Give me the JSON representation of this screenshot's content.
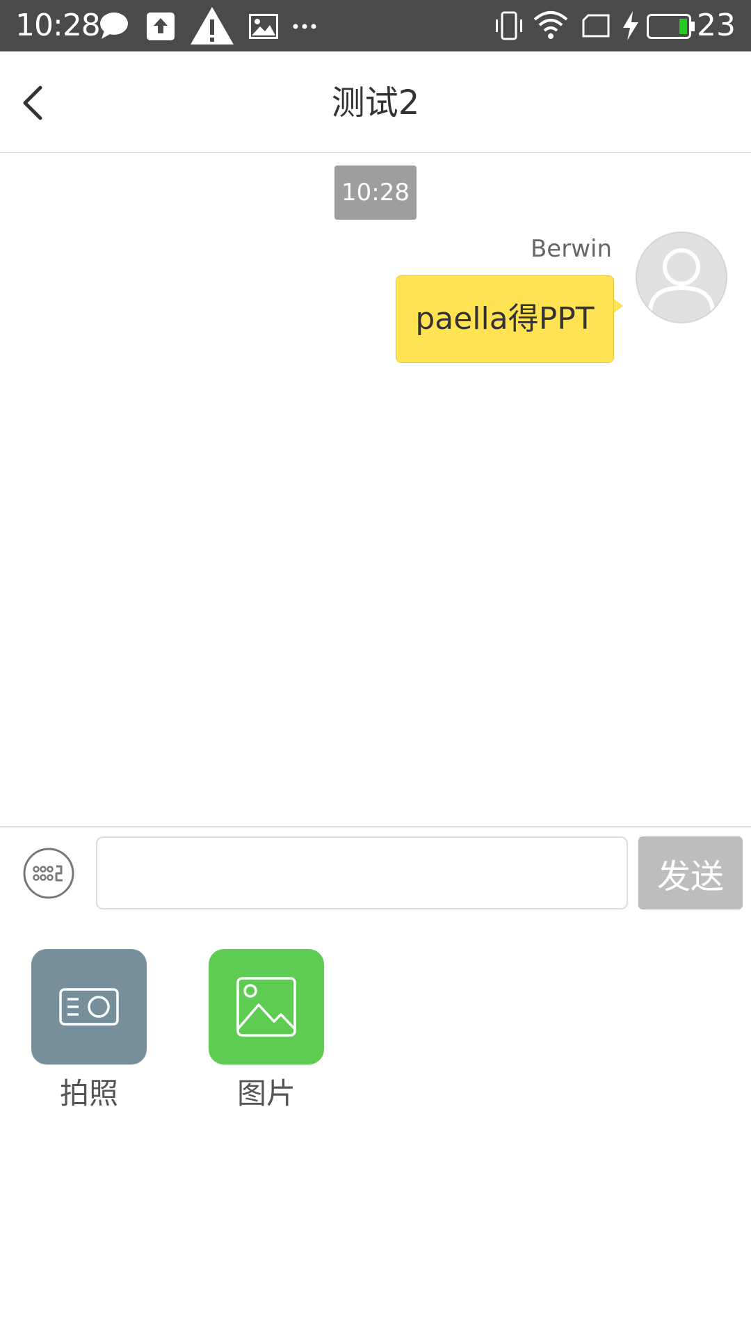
{
  "status_bar": {
    "time": "10:28",
    "battery_level": "23",
    "background_color": "#4a4a4a"
  },
  "header": {
    "title": "测试2",
    "back_icon": "chevron-left-icon"
  },
  "chat": {
    "timestamp": "10:28",
    "messages": [
      {
        "sender": "Berwin",
        "text": "paella得PPT",
        "direction": "outgoing",
        "bubble_color": "#ffe352"
      }
    ]
  },
  "composer": {
    "input_value": "",
    "send_label": "发送",
    "keyboard_icon": "keyboard-icon"
  },
  "attachments": [
    {
      "label": "拍照",
      "icon": "camera-icon",
      "color": "#778f9b"
    },
    {
      "label": "图片",
      "icon": "image-icon",
      "color": "#5ecc52"
    }
  ]
}
